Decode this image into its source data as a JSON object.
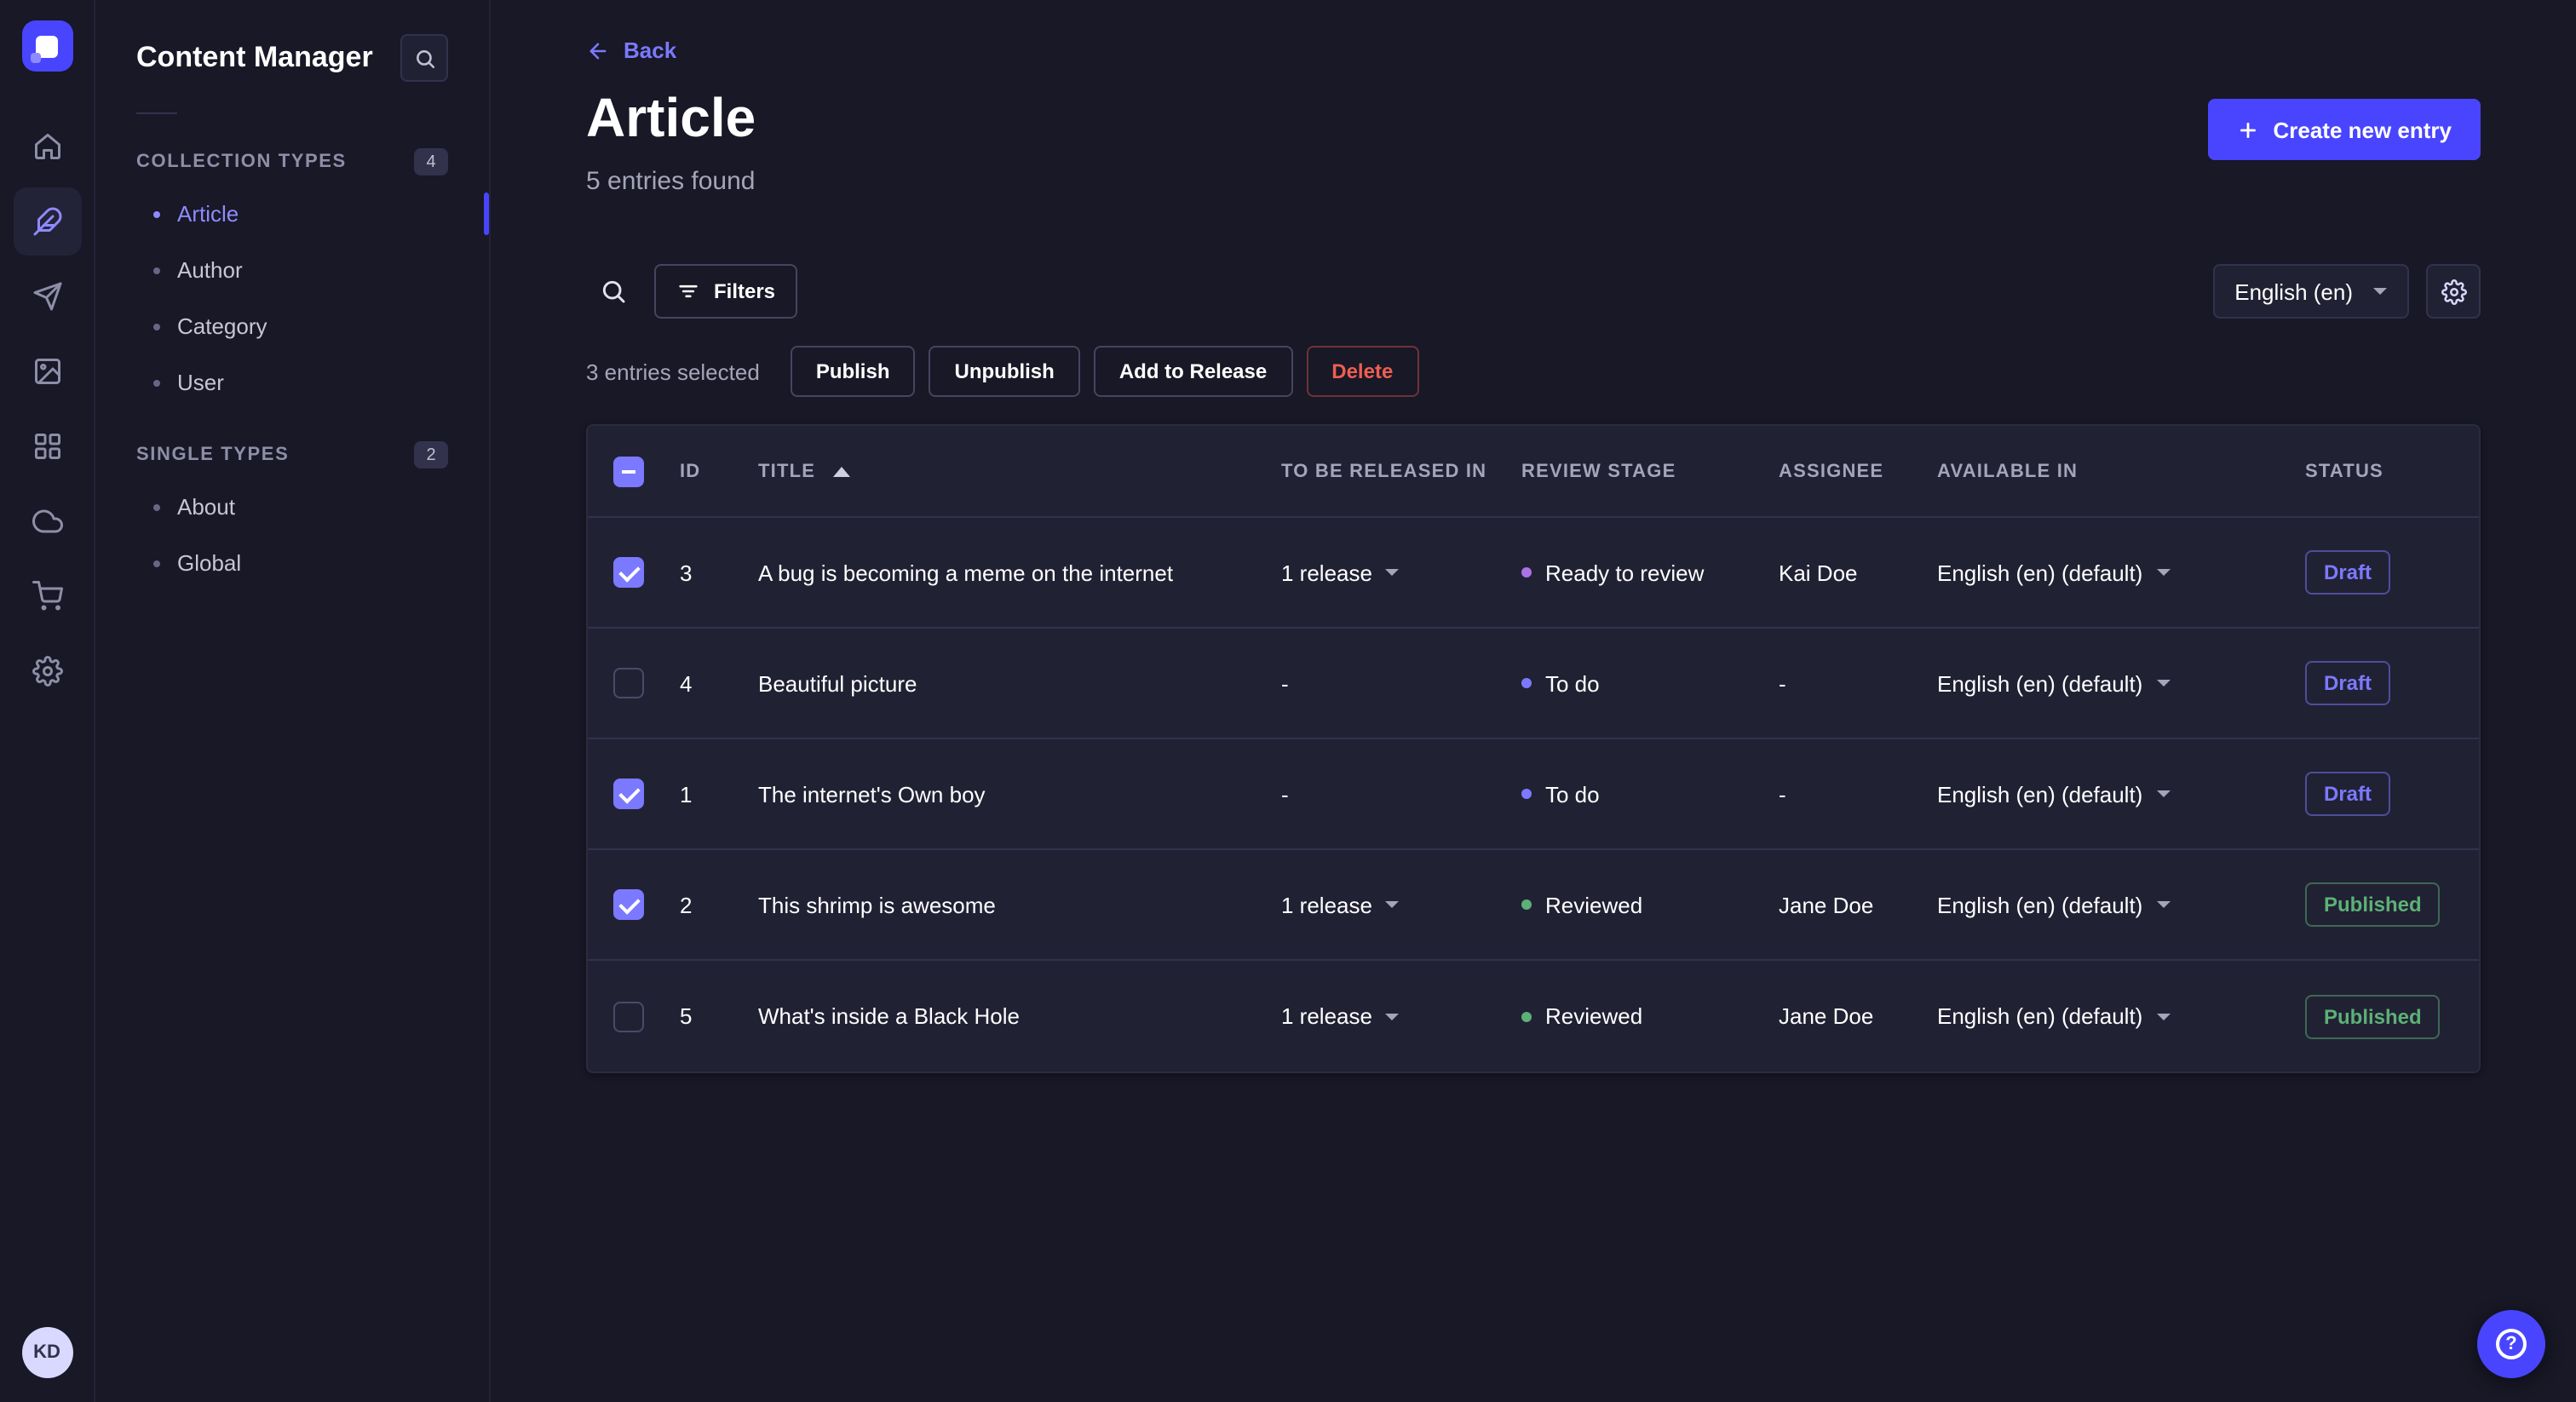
{
  "colors": {
    "accent": "#4945ff",
    "accent_light": "#7b79ff",
    "success": "#5cb176",
    "danger": "#ee5e52",
    "stage_ready_to_review": "#ac73e6",
    "stage_to_do": "#7b79ff",
    "stage_reviewed": "#5cb176",
    "page_bg": "#181826",
    "panel_bg": "#212134"
  },
  "nav_rail": {
    "logo_icon": "strapi-logo",
    "icons": [
      "home-icon",
      "content-manager-icon",
      "releases-icon",
      "media-library-icon",
      "content-type-builder-icon",
      "deploy-icon",
      "marketplace-icon",
      "settings-icon"
    ],
    "active_icon": "content-manager-icon",
    "avatar_initials": "KD"
  },
  "sidebar": {
    "title": "Content Manager",
    "search_icon": "search-icon",
    "sections": [
      {
        "label": "COLLECTION TYPES",
        "badge": "4",
        "items": [
          {
            "label": "Article",
            "active": true
          },
          {
            "label": "Author",
            "active": false
          },
          {
            "label": "Category",
            "active": false
          },
          {
            "label": "User",
            "active": false
          }
        ]
      },
      {
        "label": "SINGLE TYPES",
        "badge": "2",
        "items": [
          {
            "label": "About",
            "active": false
          },
          {
            "label": "Global",
            "active": false
          }
        ]
      }
    ]
  },
  "header": {
    "back_label": "Back",
    "title": "Article",
    "subtitle": "5 entries found",
    "create_button_label": "Create new entry"
  },
  "toolbar": {
    "filters_label": "Filters",
    "locale_value": "English (en)"
  },
  "selection": {
    "text": "3 entries selected",
    "publish_label": "Publish",
    "unpublish_label": "Unpublish",
    "add_to_release_label": "Add to Release",
    "delete_label": "Delete"
  },
  "table": {
    "columns": [
      "ID",
      "TITLE",
      "TO BE RELEASED IN",
      "REVIEW STAGE",
      "ASSIGNEE",
      "AVAILABLE IN",
      "STATUS"
    ],
    "sorted_column": "TITLE",
    "sort_direction": "ascending",
    "rows": [
      {
        "checked": true,
        "id": "3",
        "title": "A bug is becoming a meme on the internet",
        "release": "1 release",
        "review": "Ready to review",
        "review_color": "#ac73e6",
        "assignee": "Kai Doe",
        "locale": "English (en) (default)",
        "status": "Draft"
      },
      {
        "checked": false,
        "id": "4",
        "title": "Beautiful picture",
        "release": "-",
        "review": "To do",
        "review_color": "#7b79ff",
        "assignee": "-",
        "locale": "English (en) (default)",
        "status": "Draft"
      },
      {
        "checked": true,
        "id": "1",
        "title": "The internet's Own boy",
        "release": "-",
        "review": "To do",
        "review_color": "#7b79ff",
        "assignee": "-",
        "locale": "English (en) (default)",
        "status": "Draft"
      },
      {
        "checked": true,
        "id": "2",
        "title": "This shrimp is awesome",
        "release": "1 release",
        "review": "Reviewed",
        "review_color": "#5cb176",
        "assignee": "Jane Doe",
        "locale": "English (en) (default)",
        "status": "Published"
      },
      {
        "checked": false,
        "id": "5",
        "title": "What's inside a Black Hole",
        "release": "1 release",
        "review": "Reviewed",
        "review_color": "#5cb176",
        "assignee": "Jane Doe",
        "locale": "English (en) (default)",
        "status": "Published"
      }
    ]
  },
  "help": {
    "icon": "question-mark-icon"
  }
}
